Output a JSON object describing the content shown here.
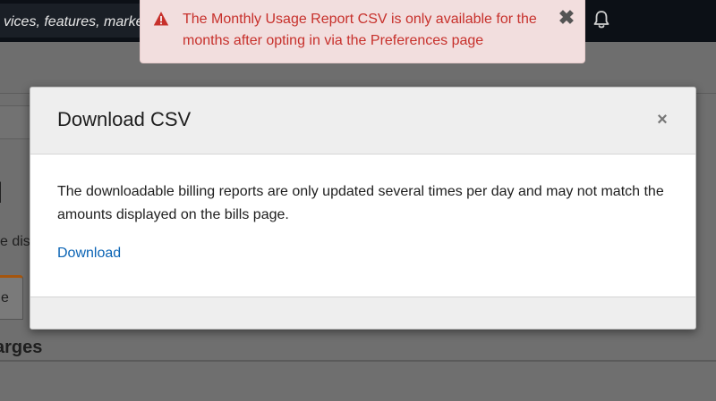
{
  "background": {
    "search_text": "vices, features, marke",
    "page_heading": "l",
    "page_subtext": "e dis",
    "active_tab_label": "e",
    "section_heading": "arges"
  },
  "alert": {
    "icon": "warning-triangle-icon",
    "message": "The Monthly Usage Report CSV is only available for the months after opting in via the Preferences page",
    "close_symbol": "✖",
    "color": "#c7302b"
  },
  "modal": {
    "title": "Download CSV",
    "close_symbol": "×",
    "body_text": "The downloadable billing reports are only updated several times per day and may not match the amounts displayed on the bills page.",
    "link_label": "Download",
    "link_color": "#0b64b5"
  },
  "icons": {
    "notifications": "bell-icon"
  }
}
